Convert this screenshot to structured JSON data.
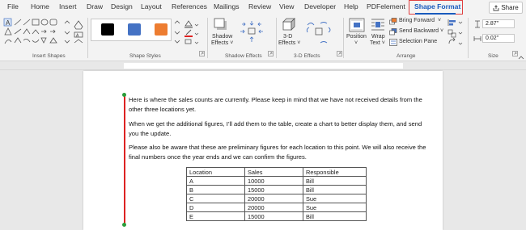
{
  "tabs": [
    "File",
    "Home",
    "Insert",
    "Draw",
    "Design",
    "Layout",
    "References",
    "Mailings",
    "Review",
    "View",
    "Developer",
    "Help",
    "PDFelement",
    "Shape Format"
  ],
  "active_tab": "Shape Format",
  "share_label": "Share",
  "ribbon": {
    "groups": {
      "insert_shapes": "Insert Shapes",
      "shape_styles": "Shape Styles",
      "shadow_effects": "Shadow Effects",
      "three_d_effects": "3-D Effects",
      "arrange": "Arrange",
      "size": "Size"
    },
    "shadow_effects_label": "Shadow",
    "shadow_effects_label2": "Effects ˅",
    "three_d_label": "3-D",
    "three_d_label2": "Effects ˅",
    "position_label": "Position",
    "position_label2": "˅",
    "wrap_label": "Wrap",
    "wrap_label2": "Text ˅",
    "bring_forward": "Bring Forward",
    "send_backward": "Send Backward",
    "selection_pane": "Selection Pane",
    "height_value": "2.87\"",
    "width_value": "0.02\"",
    "swatch_colors": [
      "#000000",
      "#4472c4",
      "#ed7d31"
    ]
  },
  "document": {
    "paragraphs": [
      "Here is where the sales counts are currently. Please keep in mind that we have not received details from the other three locations yet.",
      "When we get the additional figures, I’ll add them to the table, create a chart to better display them, and send you the update.",
      "Please also be aware that these are preliminary figures for each location to this point. We will also receive the final numbers once the year ends and we can confirm the figures."
    ],
    "table": {
      "headers": [
        "Location",
        "Sales",
        "Responsible"
      ],
      "rows": [
        [
          "A",
          "10000",
          "Bill"
        ],
        [
          "B",
          "15000",
          "Bill"
        ],
        [
          "C",
          "20000",
          "Sue"
        ],
        [
          "D",
          "20000",
          "Sue"
        ],
        [
          "E",
          "15000",
          "Bill"
        ]
      ]
    }
  }
}
